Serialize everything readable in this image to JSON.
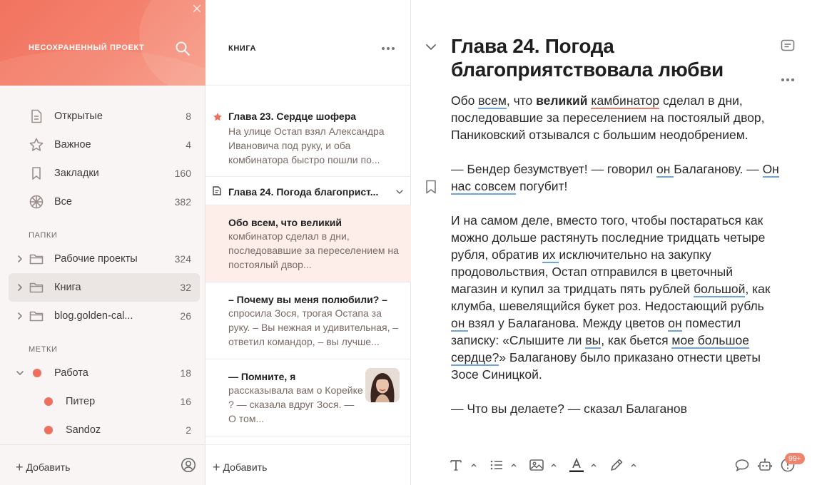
{
  "sidebar": {
    "project_title": "НЕСОХРАНЕННЫЙ ПРОЕКТ",
    "nav": [
      {
        "label": "Открытые",
        "count": "8",
        "icon": "file-icon"
      },
      {
        "label": "Важное",
        "count": "4",
        "icon": "star-icon"
      },
      {
        "label": "Закладки",
        "count": "160",
        "icon": "bookmark-icon"
      },
      {
        "label": "Все",
        "count": "382",
        "icon": "all-notes-icon"
      }
    ],
    "folders_label": "ПАПКИ",
    "folders": [
      {
        "label": "Рабочие проекты",
        "count": "324"
      },
      {
        "label": "Книга",
        "count": "32",
        "selected": true
      },
      {
        "label": "blog.golden-cal...",
        "count": "26"
      }
    ],
    "tags_label": "МЕТКИ",
    "tags": [
      {
        "label": "Работа",
        "count": "18",
        "color": "#ee6f5c"
      },
      {
        "label": "Питер",
        "count": "16",
        "color": "#ee6f5c"
      },
      {
        "label": "Sandoz",
        "count": "2",
        "color": "#ee6f5c"
      }
    ],
    "add_label": "Добавить"
  },
  "notelist": {
    "title": "КНИГА",
    "notes": [
      {
        "title": "Глава 23. Сердце шофера",
        "snippet": "На улице Остап взял Александра Ивановича под руку, и оба комбинатора быстро пошли по...",
        "starred": true
      },
      {
        "title": "Глава 24. Погода благоприст..."
      },
      {
        "title": "Обо всем, что великий",
        "snippet": "комбинатор сделал в дни, последовавшие за переселением на постоялый двор..."
      },
      {
        "title": "– Почему вы меня полюбили? –",
        "snippet": "спросила Зося, трогая Остапа за руку. – Вы нежная и удивительная, – ответил командор, – вы лучше..."
      },
      {
        "title": "— Помните, я",
        "snippet": "рассказывала вам о Корейке ? — сказала вдруг Зося. — О том..."
      }
    ],
    "add_label": "Добавить"
  },
  "editor": {
    "title": "Глава 24. Погода благоприятствовала любви",
    "body": {
      "p1": [
        "Обо ",
        "всем",
        ", что ",
        "великий",
        " ",
        "камбинатор",
        " сделал в дни, последовавшие за переселением на постоялый двор, Паниковский отзывался с большим неодобрением."
      ],
      "p2": [
        "— Бендер безумствует! — говорил ",
        "он ",
        "Балаганову. — ",
        "Он нас совсем",
        " погубит!"
      ],
      "p3": [
        "И на самом деле, вместо того, чтобы постараться как можно дольше растянуть последние тридцать четыре рубля, обратив ",
        "их ",
        "исключительно на закупку продовольствия, Остап отправился в цветочный магазин и купил за тридцать пять рублей ",
        "большой",
        ", как клумба, шевелящийся букет роз. Недостающий рубль ",
        "он ",
        "взял у Балаганова. Между цветов ",
        "он",
        " поместил записку: «Слышите ли ",
        "вы",
        ", как бьется ",
        "мое большое сердце?",
        "» Балаганову было приказано отнести цветы Зосе Синицкой."
      ],
      "p4": "— Что вы делаете? — сказал Балаганов"
    },
    "notifications_badge": "99+"
  },
  "colors": {
    "accent": "#f1735f",
    "spell_underline": "#6ea2e6",
    "grammar_underline": "#ee7a6c",
    "active_note_bg": "#fdeeea"
  }
}
